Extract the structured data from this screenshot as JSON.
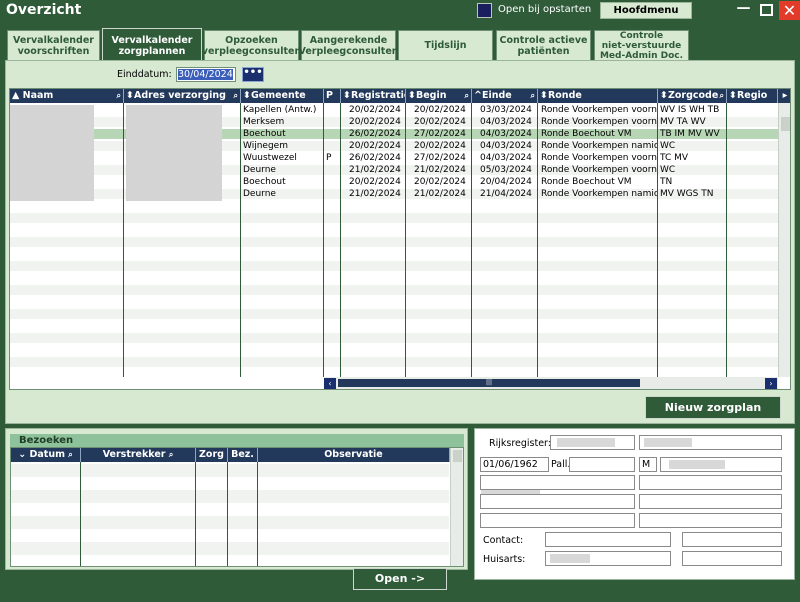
{
  "window": {
    "title": "Overzicht",
    "open_bij_opstarten_label": "Open bij opstarten",
    "hoofdmenu_label": "Hoofdmenu",
    "minimize_glyph": "—",
    "close_glyph": "✕"
  },
  "tabs": [
    {
      "line1": "Vervalkalender",
      "line2": "voorschriften",
      "active": false
    },
    {
      "line1": "Vervalkalender",
      "line2": "zorgplannen",
      "active": true
    },
    {
      "line1": "Opzoeken",
      "line2": "verpleegconsulten",
      "active": false
    },
    {
      "line1": "Aangerekende",
      "line2": "Verpleegconsulten",
      "active": false
    },
    {
      "line1": "Tijdslijn",
      "line2": "",
      "active": false
    },
    {
      "line1": "Controle actieve",
      "line2": "patiënten",
      "active": false
    },
    {
      "line1": "Controle",
      "line2": "niet-verstuurde",
      "line3": "Med-Admin Doc.",
      "active": false
    }
  ],
  "filter": {
    "einddatum_label": "Einddatum:",
    "einddatum_value": "30/04/2024",
    "dots_label": "•••"
  },
  "grid": {
    "columns": {
      "naam": "Naam",
      "adres": "Adres verzorging",
      "gemeente": "Gemeente",
      "p": "P",
      "registratie": "Registratie",
      "begin": "Begin",
      "einde": "Einde",
      "ronde": "Ronde",
      "zorgcode": "Zorgcode",
      "regio": "Regio"
    },
    "rows": [
      {
        "gemeente": "Kapellen (Antw.)",
        "p": "",
        "registratie": "20/02/2024",
        "begin": "20/02/2024",
        "einde": "03/03/2024",
        "ronde": "Ronde Voorkempen voorn",
        "zorgcode": "WV IS WH TB"
      },
      {
        "gemeente": "Merksem",
        "p": "",
        "registratie": "20/02/2024",
        "begin": "20/02/2024",
        "einde": "04/03/2024",
        "ronde": "Ronde Voorkempen voorn",
        "zorgcode": "MV TA WV"
      },
      {
        "gemeente": "Boechout",
        "p": "",
        "registratie": "26/02/2024",
        "begin": "27/02/2024",
        "einde": "04/03/2024",
        "ronde": "Ronde Boechout VM",
        "zorgcode": "TB IM MV WV"
      },
      {
        "gemeente": "Wijnegem",
        "p": "",
        "registratie": "20/02/2024",
        "begin": "20/02/2024",
        "einde": "04/03/2024",
        "ronde": "Ronde Voorkempen namic",
        "zorgcode": "WC"
      },
      {
        "gemeente": "Wuustwezel",
        "p": "P",
        "registratie": "26/02/2024",
        "begin": "27/02/2024",
        "einde": "04/03/2024",
        "ronde": "Ronde Voorkempen voorn",
        "zorgcode": "TC MV"
      },
      {
        "gemeente": "Deurne",
        "p": "",
        "registratie": "21/02/2024",
        "begin": "21/02/2024",
        "einde": "05/03/2024",
        "ronde": "Ronde Voorkempen voorn",
        "zorgcode": "WC"
      },
      {
        "gemeente": "Boechout",
        "p": "",
        "registratie": "20/02/2024",
        "begin": "20/02/2024",
        "einde": "20/04/2024",
        "ronde": "Ronde Boechout VM",
        "zorgcode": "TN"
      },
      {
        "gemeente": "Deurne",
        "p": "",
        "registratie": "21/02/2024",
        "begin": "21/02/2024",
        "einde": "21/04/2024",
        "ronde": "Ronde Voorkempen namic",
        "zorgcode": "MV WGS TN"
      }
    ],
    "selected_row": 2,
    "hscroll_thumb": "|||"
  },
  "nieuw_zorgplan_label": "Nieuw zorgplan",
  "bezoeken": {
    "title": "Bezoeken",
    "columns": {
      "datum": "Datum",
      "verstrekker": "Verstrekker",
      "zorg": "Zorg",
      "bez": "Bez.",
      "observatie": "Observatie"
    }
  },
  "open_label": "Open ->",
  "patient": {
    "rijksregister_label": "Rijksregister:",
    "birthdate": "01/06/1962",
    "pall_label": "Pall.",
    "gender": "M",
    "contact_label": "Contact:",
    "huisarts_label": "Huisarts:"
  }
}
